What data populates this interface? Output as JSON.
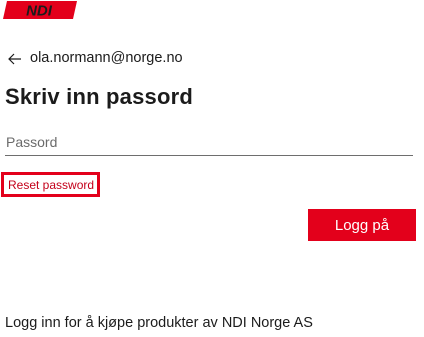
{
  "brand": {
    "logo_icon": "ndi-logo-icon",
    "logo_text": "NDI",
    "accent_color": "#e3001b"
  },
  "identity": {
    "back_icon": "back-arrow-icon",
    "email": "ola.normann@norge.no"
  },
  "title": "Skriv inn passord",
  "password": {
    "placeholder": "Passord",
    "value": ""
  },
  "reset_link": "Reset password",
  "signin_button": "Logg på",
  "footer": "Logg inn for å kjøpe produkter av NDI Norge AS"
}
